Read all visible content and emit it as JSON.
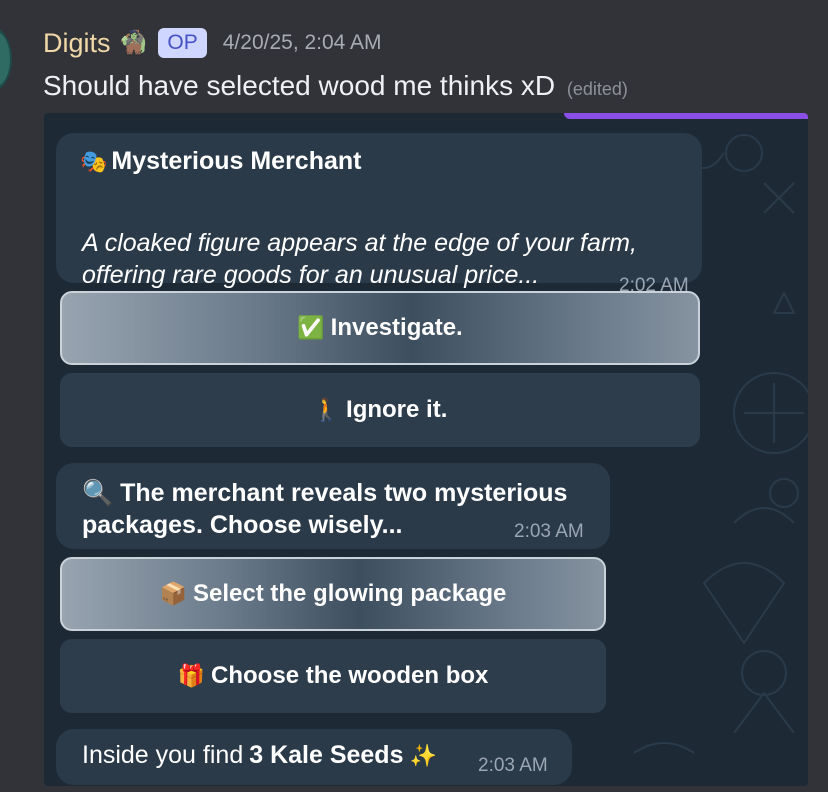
{
  "message": {
    "author": "Digits",
    "author_emoji": "🧌",
    "badge": "OP",
    "timestamp": "4/20/25, 2:04 AM",
    "text": "Should have selected wood me thinks xD",
    "edited_label": "(edited)"
  },
  "screenshot": {
    "bubble1": {
      "icon": "🎭",
      "title": "Mysterious Merchant",
      "body": "A cloaked figure appears at the edge of your farm, offering rare goods for an unusual price...",
      "time": "2:02 AM"
    },
    "buttons1": [
      {
        "emoji": "✅",
        "label": "Investigate."
      },
      {
        "emoji": "🚶",
        "label": "Ignore it."
      }
    ],
    "bubble2": {
      "text": "🔍 The merchant reveals two mysterious packages. Choose wisely...",
      "time": "2:03 AM"
    },
    "buttons2": [
      {
        "emoji": "📦",
        "label": "Select the glowing package"
      },
      {
        "emoji": "🎁",
        "label": "Choose the wooden box"
      }
    ],
    "bubble3": {
      "prefix": "Inside you find",
      "item": "3 Kale Seeds",
      "emoji": "✨",
      "time": "2:03 AM"
    }
  }
}
